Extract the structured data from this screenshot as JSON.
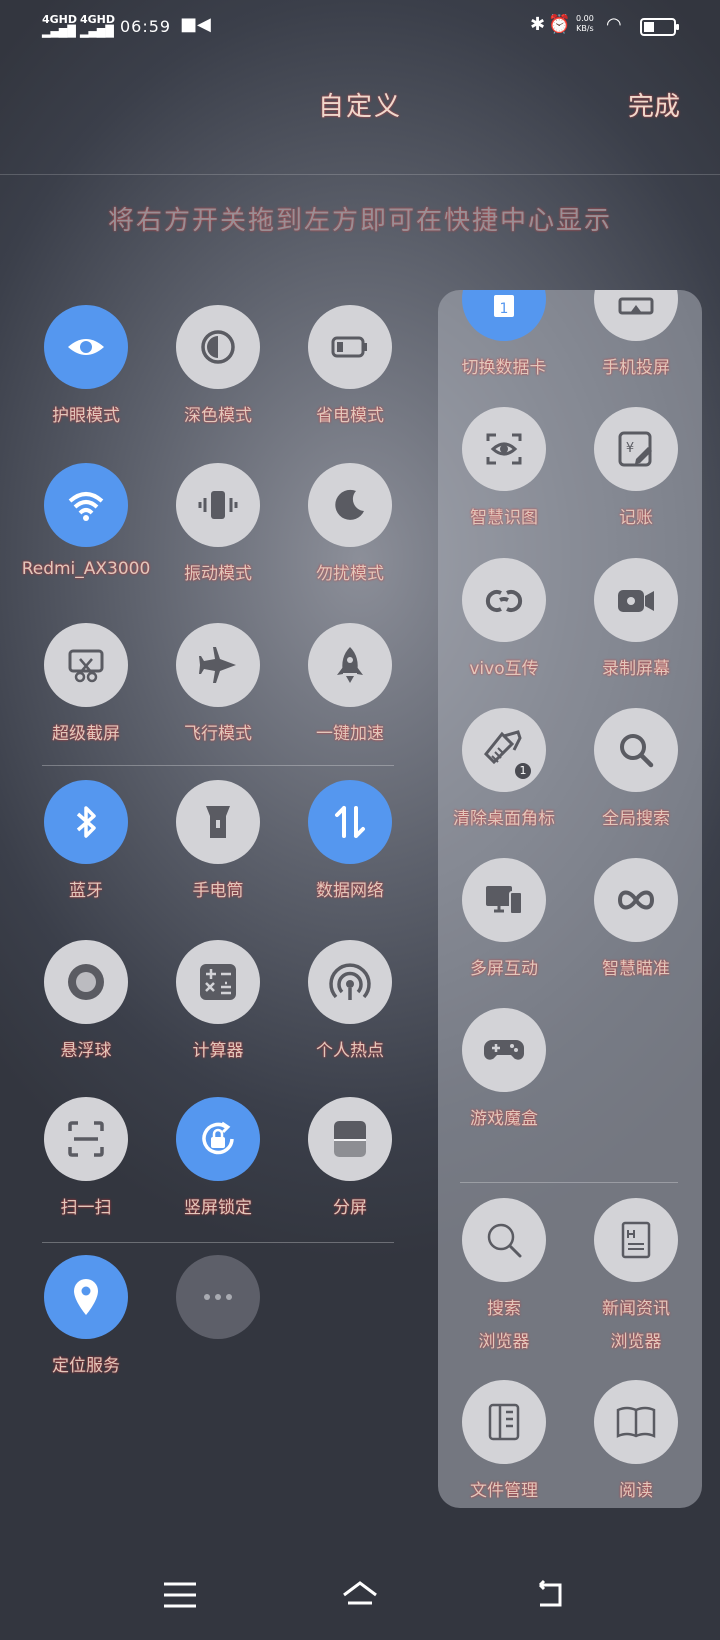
{
  "status": {
    "sim1": "4GHD",
    "sim2": "4GHD",
    "time": "06:59",
    "speed": "0.00",
    "speed_unit": "KB/s"
  },
  "header": {
    "title": "自定义",
    "done_label": "完成"
  },
  "hint": "将右方开关拖到左方即可在快捷中心显示",
  "active_tiles": [
    {
      "label": "护眼模式",
      "icon": "eye-icon",
      "on": true
    },
    {
      "label": "深色模式",
      "icon": "contrast-icon",
      "on": false
    },
    {
      "label": "省电模式",
      "icon": "battery-icon",
      "on": false
    },
    {
      "label": "Redmi_AX3000",
      "icon": "wifi-icon",
      "on": true
    },
    {
      "label": "振动模式",
      "icon": "vibrate-icon",
      "on": false
    },
    {
      "label": "勿扰模式",
      "icon": "moon-icon",
      "on": false
    },
    {
      "label": "超级截屏",
      "icon": "screenshot-icon",
      "on": false
    },
    {
      "label": "飞行模式",
      "icon": "airplane-icon",
      "on": false
    },
    {
      "label": "一键加速",
      "icon": "rocket-icon",
      "on": false
    },
    {
      "label": "蓝牙",
      "icon": "bluetooth-icon",
      "on": true
    },
    {
      "label": "手电筒",
      "icon": "flashlight-icon",
      "on": false
    },
    {
      "label": "数据网络",
      "icon": "data-network-icon",
      "on": true
    },
    {
      "label": "悬浮球",
      "icon": "floating-ball-icon",
      "on": false
    },
    {
      "label": "计算器",
      "icon": "calculator-icon",
      "on": false
    },
    {
      "label": "个人热点",
      "icon": "hotspot-icon",
      "on": false
    },
    {
      "label": "扫一扫",
      "icon": "scan-icon",
      "on": false
    },
    {
      "label": "竖屏锁定",
      "icon": "rotation-lock-icon",
      "on": true
    },
    {
      "label": "分屏",
      "icon": "split-screen-icon",
      "on": false
    },
    {
      "label": "定位服务",
      "icon": "location-icon",
      "on": true
    },
    {
      "label": "",
      "icon": "more-icon",
      "on": false
    }
  ],
  "available_tiles": [
    {
      "label": "切换数据卡",
      "icon": "sim-switch-icon",
      "on": true
    },
    {
      "label": "手机投屏",
      "icon": "cast-icon",
      "on": false
    },
    {
      "label": "智慧识图",
      "icon": "smart-vision-icon",
      "on": false
    },
    {
      "label": "记账",
      "icon": "ledger-icon",
      "on": false
    },
    {
      "label": "vivo互传",
      "icon": "share-link-icon",
      "on": false
    },
    {
      "label": "录制屏幕",
      "icon": "screen-record-icon",
      "on": false
    },
    {
      "label": "清除桌面角标",
      "icon": "clear-badge-icon",
      "on": false,
      "badge": "1"
    },
    {
      "label": "全局搜索",
      "icon": "global-search-icon",
      "on": false
    },
    {
      "label": "多屏互动",
      "icon": "multi-screen-icon",
      "on": false
    },
    {
      "label": "智慧瞄准",
      "icon": "infinity-icon",
      "on": false
    },
    {
      "label": "游戏魔盒",
      "icon": "gamepad-icon",
      "on": false
    }
  ],
  "app_tiles": [
    {
      "label": "搜索",
      "label2": "浏览器",
      "icon": "search-icon"
    },
    {
      "label": "新闻资讯",
      "label2": "浏览器",
      "icon": "news-icon"
    },
    {
      "label": "文件管理",
      "label2": "",
      "icon": "file-manager-icon"
    },
    {
      "label": "阅读",
      "label2": "",
      "icon": "book-icon"
    }
  ]
}
